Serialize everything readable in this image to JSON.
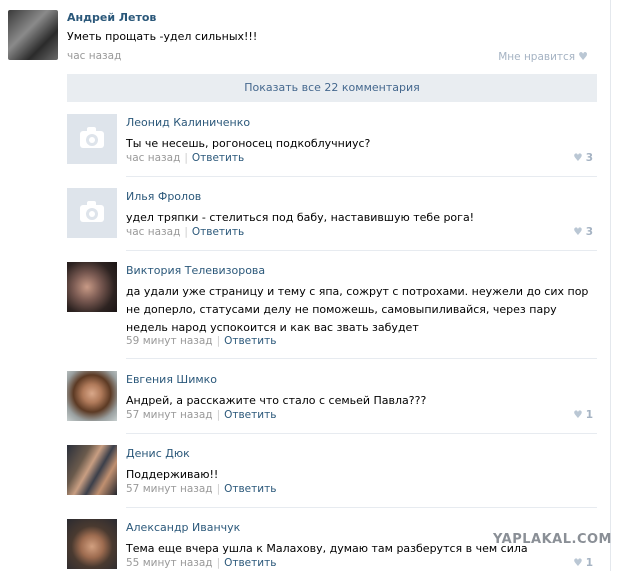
{
  "post": {
    "author": "Андрей Летов",
    "text": "Уметь прощать -удел сильных!!!",
    "time": "час назад",
    "like_label": "Мне нравится",
    "like_icon": "heart-icon"
  },
  "show_all_label": "Показать все 22 комментария",
  "comments": [
    {
      "name": "Леонид Калиниченко",
      "text": "Ты че несешь, рогоносец подкоблучниус?",
      "time": "час назад",
      "reply": "Ответить",
      "likes": "3",
      "avatar": "camera-icon"
    },
    {
      "name": "Илья Фролов",
      "text": "удел тряпки - стелиться под бабу, наставившую тебе рога!",
      "time": "час назад",
      "reply": "Ответить",
      "likes": "3",
      "avatar": "camera-icon"
    },
    {
      "name": "Виктория Телевизорова",
      "text": "да удали уже страницу и тему с япа, сожрут с потрохами. неужели до сих пор не доперло, статусами делу не поможешь, самовыпиливайся, через пару недель народ успокоится и как вас звать забудет",
      "time": "59 минут назад",
      "reply": "Ответить",
      "likes": ""
    },
    {
      "name": "Евгения Шимко",
      "text": "Андрей, а расскажите что стало с семьей Павла???",
      "time": "57 минут назад",
      "reply": "Ответить",
      "likes": "1"
    },
    {
      "name": "Денис Дюк",
      "text": "Поддерживаю!!",
      "time": "57 минут назад",
      "reply": "Ответить",
      "likes": ""
    },
    {
      "name": "Александр Иванчук",
      "text": "Тема еще вчера ушла к Малахову, думаю там разберутся в чем сила",
      "time": "55 минут назад",
      "reply": "Ответить",
      "likes": "1"
    }
  ],
  "separator": "|",
  "watermark": "YAPLAKAL.COM"
}
